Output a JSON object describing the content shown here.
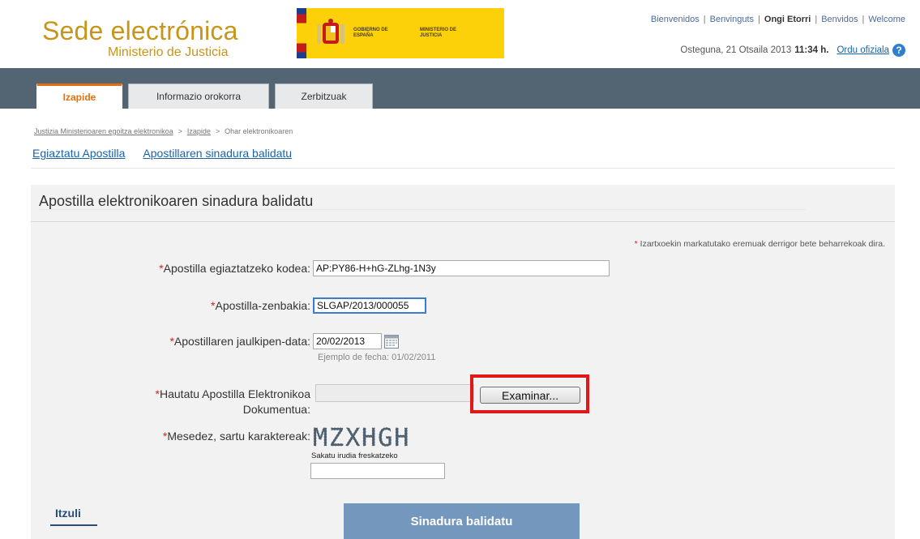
{
  "header": {
    "title": "Sede electrónica",
    "subtitle": "Ministerio de Justicia",
    "gov_text": "GOBIERNO DE ESPAÑA",
    "ministry_text": "MINISTERIO DE JUSTICIA",
    "languages": [
      "Bienvenidos",
      "Benvinguts",
      "Ongi Etorri",
      "Benvidos",
      "Welcome"
    ],
    "current_language": "Ongi Etorri",
    "date": "Osteguna, 21 Otsaila 2013",
    "time": "11:34 h.",
    "official_time_link": "Ordu ofiziala"
  },
  "nav": {
    "tabs": [
      {
        "label": "Izapide",
        "active": true
      },
      {
        "label": "Informazio orokorra",
        "active": false
      },
      {
        "label": "Zerbitzuak",
        "active": false
      }
    ]
  },
  "breadcrumb": {
    "items": [
      "Justizia Ministerioaren egoitza elektronikoa",
      "Izapide",
      "Ohar elektronikoaren"
    ],
    "separator": ">"
  },
  "sub_links": [
    "Egiaztatu Apostilla",
    "Apostillaren sinadura balidatu"
  ],
  "form": {
    "title": "Apostilla elektronikoaren sinadura balidatu",
    "required_note": "Izartxoekin markatutako eremuak derrigor bete beharrekoak dira.",
    "required_mark": "*",
    "code_label": "Apostilla egiaztatzeko kodea:",
    "code_value": "AP:PY86-H+hG-ZLhg-1N3y",
    "number_label": "Apostilla-zenbakia:",
    "number_value": "SLGAP/2013/000055",
    "date_label": "Apostillaren jaulkipen-data:",
    "date_value": "20/02/2013",
    "date_hint": "Ejemplo de fecha: 01/02/2011",
    "doc_label_line1": "Hautatu Apostilla Elektronikoa",
    "doc_label_line2": "Dokumentua:",
    "doc_value": "",
    "browse_button": "Examinar...",
    "captcha_label": "Mesedez, sartu karaktereak:",
    "captcha_text": "MZXHGH",
    "captcha_refresh": "Sakatu irudia freskatzeko",
    "captcha_value": "",
    "back_link": "Itzuli",
    "submit_button": "Sinadura balidatu"
  },
  "colors": {
    "brand": "#c7951a",
    "nav_bg": "#536573",
    "active_tab": "#e07010",
    "link": "#1b63a8",
    "submit_bg": "#7497bd",
    "highlight": "#e01818"
  }
}
